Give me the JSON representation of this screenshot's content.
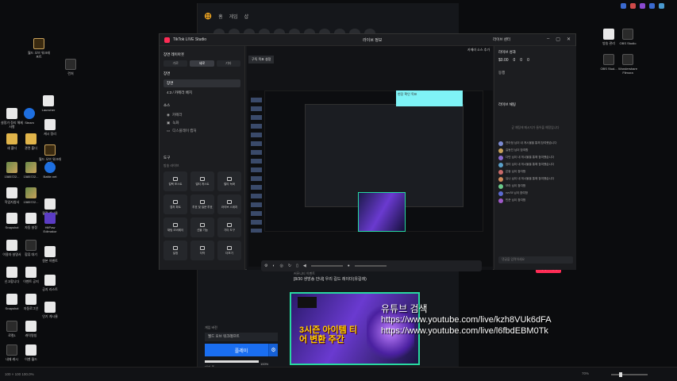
{
  "desktop": {
    "icons_left": [
      {
        "label": "월드 오브 워크래프트",
        "kind": "gold"
      },
      {
        "label": "런처",
        "kind": "dark"
      },
      {
        "label": "Launcher",
        "kind": "file"
      },
      {
        "label": "설정가 정리 해제 사항",
        "kind": "file"
      },
      {
        "label": "Steam",
        "kind": "blue"
      },
      {
        "label": "캐시 정리",
        "kind": "file"
      },
      {
        "label": "새 폴더",
        "kind": "folder"
      },
      {
        "label": "관련 폴더",
        "kind": "folder"
      },
      {
        "label": "월드 오브 워크래프트",
        "kind": "gold"
      },
      {
        "label": "1585722...",
        "kind": "img"
      },
      {
        "label": "1585722...",
        "kind": "img"
      },
      {
        "label": "Battle.net",
        "kind": "blue"
      },
      {
        "label": "작업지침서",
        "kind": "file"
      },
      {
        "label": "1585722...",
        "kind": "img"
      },
      {
        "label": "월정 게시물",
        "kind": "file"
      },
      {
        "label": "Snapshot",
        "kind": "file"
      },
      {
        "label": "자동 설정",
        "kind": "file"
      },
      {
        "label": "HitPaw Edimakor",
        "kind": "purple"
      },
      {
        "label": "이용자 설명서",
        "kind": "file"
      },
      {
        "label": "합류 대기",
        "kind": "dark"
      },
      {
        "label": "원본 이벤트",
        "kind": "file"
      },
      {
        "label": "신고합니다",
        "kind": "file"
      },
      {
        "label": "이벤트 공지",
        "kind": "file"
      },
      {
        "label": "공지 리스트",
        "kind": "file"
      },
      {
        "label": "Snapshot",
        "kind": "file"
      },
      {
        "label": "자동로그인",
        "kind": "file"
      },
      {
        "label": "인기 게시물",
        "kind": "file"
      },
      {
        "label": "로컬1",
        "kind": "dark"
      },
      {
        "label": "캐릭명칭",
        "kind": "file"
      },
      {
        "label": "내재 캐시",
        "kind": "dark"
      },
      {
        "label": "이벤 월드",
        "kind": "file"
      }
    ],
    "icons_right": [
      {
        "label": "방송 관리",
        "kind": "file"
      },
      {
        "label": "OBS Studio",
        "kind": "dark"
      },
      {
        "label": "OBS Stud...",
        "kind": "dark"
      },
      {
        "label": "Wondershare Filmora",
        "kind": "dark"
      }
    ]
  },
  "launcher": {
    "nav": [
      "홈",
      "게임",
      "샵"
    ],
    "post_meta": "커뮤니티 이벤트",
    "post_title": "[8/30 생방송 안내] 우리 길드 레이더(유길레)",
    "banner_text": "3시즌 아이템 티어 변환 주간",
    "play_label": "게임 버전",
    "play_select": "월드 오브 워크래프트",
    "play_button": "플레이",
    "progress_pct": "100%",
    "progress_value": 1.0,
    "status_text": "대기 중"
  },
  "overlay": {
    "line1": "유튜브 검색",
    "line2": "https://www.youtube.com/live/kzh8VUk6dFA",
    "line3": "https://www.youtube.com/live/l6fbdEBM0Tk"
  },
  "studio": {
    "app_title": "TikTok LIVE Studio",
    "center_title": "라이브 정보",
    "top_actions": [
      "라이브 센터"
    ],
    "left": {
      "layout_heading": "장면 레이아웃",
      "ratio_options": [
        "가로",
        "세로",
        "기타"
      ],
      "scenes_heading": "장면",
      "scenes": [
        "장면",
        "4:3 / 카메라 배치"
      ],
      "sources_heading": "소스",
      "sources": [
        "카메라",
        "녹화",
        "디스플레이 캡처"
      ],
      "tools_heading": "도구",
      "tools_sub": "방송 라이브",
      "tools": [
        "컬렉 포스트",
        "멀티 게스트",
        "멀티 녹화",
        "캡처 파트",
        "투표 및 질문 투표",
        "라이브 스위치",
        "채팅 오버레이",
        "선물 기능",
        "기타 도구",
        "설정",
        "자막",
        "더보기"
      ]
    },
    "preview": {
      "tag": "구독 목표 설정",
      "right_tag": "카메라 소스 추가",
      "cyan_label": "현장 확인 목표",
      "go_live": "라이브 시작"
    },
    "right": {
      "summary_heading": "라이브 성과",
      "stats": [
        "$0.00",
        "0",
        "0",
        "0"
      ],
      "guest_label": "동행",
      "chat_heading": "라이브 채팅",
      "chat_empty": "곧 채팅에 메시지가 들어올 예정입니다",
      "messages": [
        {
          "user": "연아정",
          "text": "님이 내 게시물을 통해 참여했습니다",
          "color": "#7a8ad0"
        },
        {
          "user": "길동진",
          "text": "님이 참여함",
          "color": "#c9a15a"
        },
        {
          "user": "다빈",
          "text": "님이 내 게시물을 통해 참여했습니다",
          "color": "#8a6ad0"
        },
        {
          "user": "장미",
          "text": "님이 내 게시물을 통해 참여했습니다",
          "color": "#5aa0c9"
        },
        {
          "user": "은동",
          "text": "님이 참여함",
          "color": "#c96a6a"
        },
        {
          "user": "유나",
          "text": "님이 내 게시물을 통해 참여했습니다",
          "color": "#d08a5a"
        },
        {
          "user": "보라",
          "text": "님이 참여함",
          "color": "#6ac98a"
        },
        {
          "user": "vvv78",
          "text": "님이 참여함",
          "color": "#5a6ad0"
        },
        {
          "user": "민준",
          "text": "님이 참여함",
          "color": "#a05ac9"
        }
      ],
      "chat_placeholder": "댓글을 입력하세요"
    }
  },
  "taskbar": {
    "left_info": "100 × 100  100.0%",
    "zoom": "70%"
  }
}
